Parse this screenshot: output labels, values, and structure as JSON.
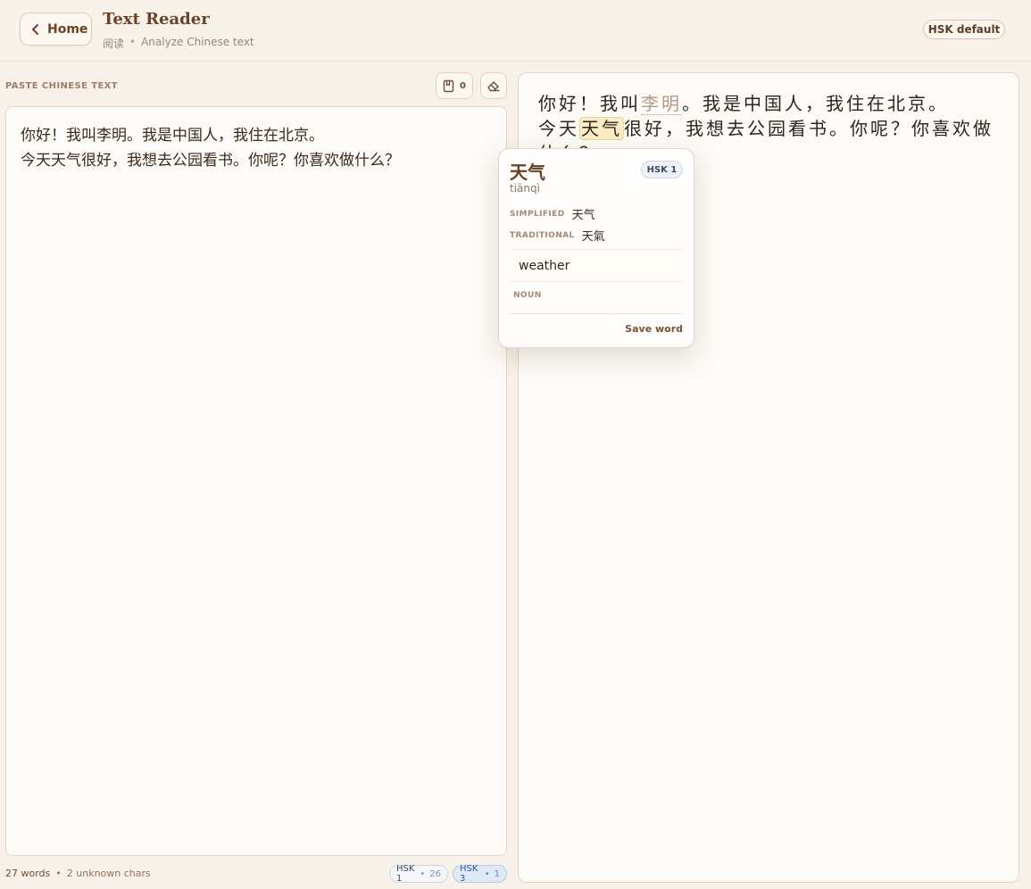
{
  "header": {
    "home_label": "Home",
    "title": "Text Reader",
    "subtitle_cn": "阅读",
    "subtitle_sep": "•",
    "subtitle_en": "Analyze Chinese text",
    "hsk_default_label": "HSK default"
  },
  "input_panel": {
    "label": "PASTE CHINESE TEXT",
    "saved_count": "0",
    "text": "你好！我叫李明。我是中国人，我住在北京。\n今天天气很好，我想去公园看书。你呢？你喜欢做什么？"
  },
  "footer": {
    "words": "27 words",
    "sep": "•",
    "unknown": "2 unknown chars",
    "badges": [
      {
        "label": "HSK 1",
        "sep": "•",
        "count": "26"
      },
      {
        "label": "HSK 3",
        "sep": "•",
        "count": "1"
      }
    ]
  },
  "reader": {
    "tokens": [
      {
        "t": "你好",
        "state": "normal"
      },
      {
        "t": "！",
        "state": "normal"
      },
      {
        "t": "我",
        "state": "normal"
      },
      {
        "t": "叫",
        "state": "normal"
      },
      {
        "t": "李明",
        "state": "unknown"
      },
      {
        "t": "。",
        "state": "normal"
      },
      {
        "t": "我",
        "state": "normal"
      },
      {
        "t": "是",
        "state": "normal"
      },
      {
        "t": "中国",
        "state": "normal"
      },
      {
        "t": "人",
        "state": "normal"
      },
      {
        "t": "，",
        "state": "normal"
      },
      {
        "t": "我",
        "state": "normal"
      },
      {
        "t": "住",
        "state": "normal"
      },
      {
        "t": "在",
        "state": "normal"
      },
      {
        "t": "北京",
        "state": "normal"
      },
      {
        "t": "。",
        "state": "normal"
      },
      {
        "t": "\n",
        "state": "break"
      },
      {
        "t": "今天",
        "state": "normal"
      },
      {
        "t": "天气",
        "state": "active"
      },
      {
        "t": "很",
        "state": "normal"
      },
      {
        "t": "好",
        "state": "normal"
      },
      {
        "t": "，",
        "state": "normal"
      },
      {
        "t": "我",
        "state": "normal"
      },
      {
        "t": "想",
        "state": "normal"
      },
      {
        "t": "去",
        "state": "normal"
      },
      {
        "t": "公园",
        "state": "normal"
      },
      {
        "t": "看",
        "state": "normal"
      },
      {
        "t": "书",
        "state": "normal"
      },
      {
        "t": "。",
        "state": "normal"
      },
      {
        "t": "你",
        "state": "normal"
      },
      {
        "t": "呢",
        "state": "normal"
      },
      {
        "t": "？",
        "state": "normal"
      },
      {
        "t": "你",
        "state": "normal"
      },
      {
        "t": "喜欢",
        "state": "normal"
      },
      {
        "t": "做",
        "state": "normal"
      },
      {
        "t": "什么",
        "state": "normal"
      },
      {
        "t": "？",
        "state": "normal"
      }
    ]
  },
  "popover": {
    "word": "天气",
    "pinyin": "tiānqì",
    "hsk": "HSK 1",
    "simplified_label": "SIMPLIFIED",
    "simplified": "天气",
    "traditional_label": "TRADITIONAL",
    "traditional": "天氣",
    "definition": "weather",
    "pos": "NOUN",
    "save_label": "Save word"
  },
  "colors": {
    "background": "#f7f1e9",
    "brand_brown": "#6a4326",
    "highlight": "#fbecc4",
    "hsk3_blue": "#2e57a8"
  }
}
